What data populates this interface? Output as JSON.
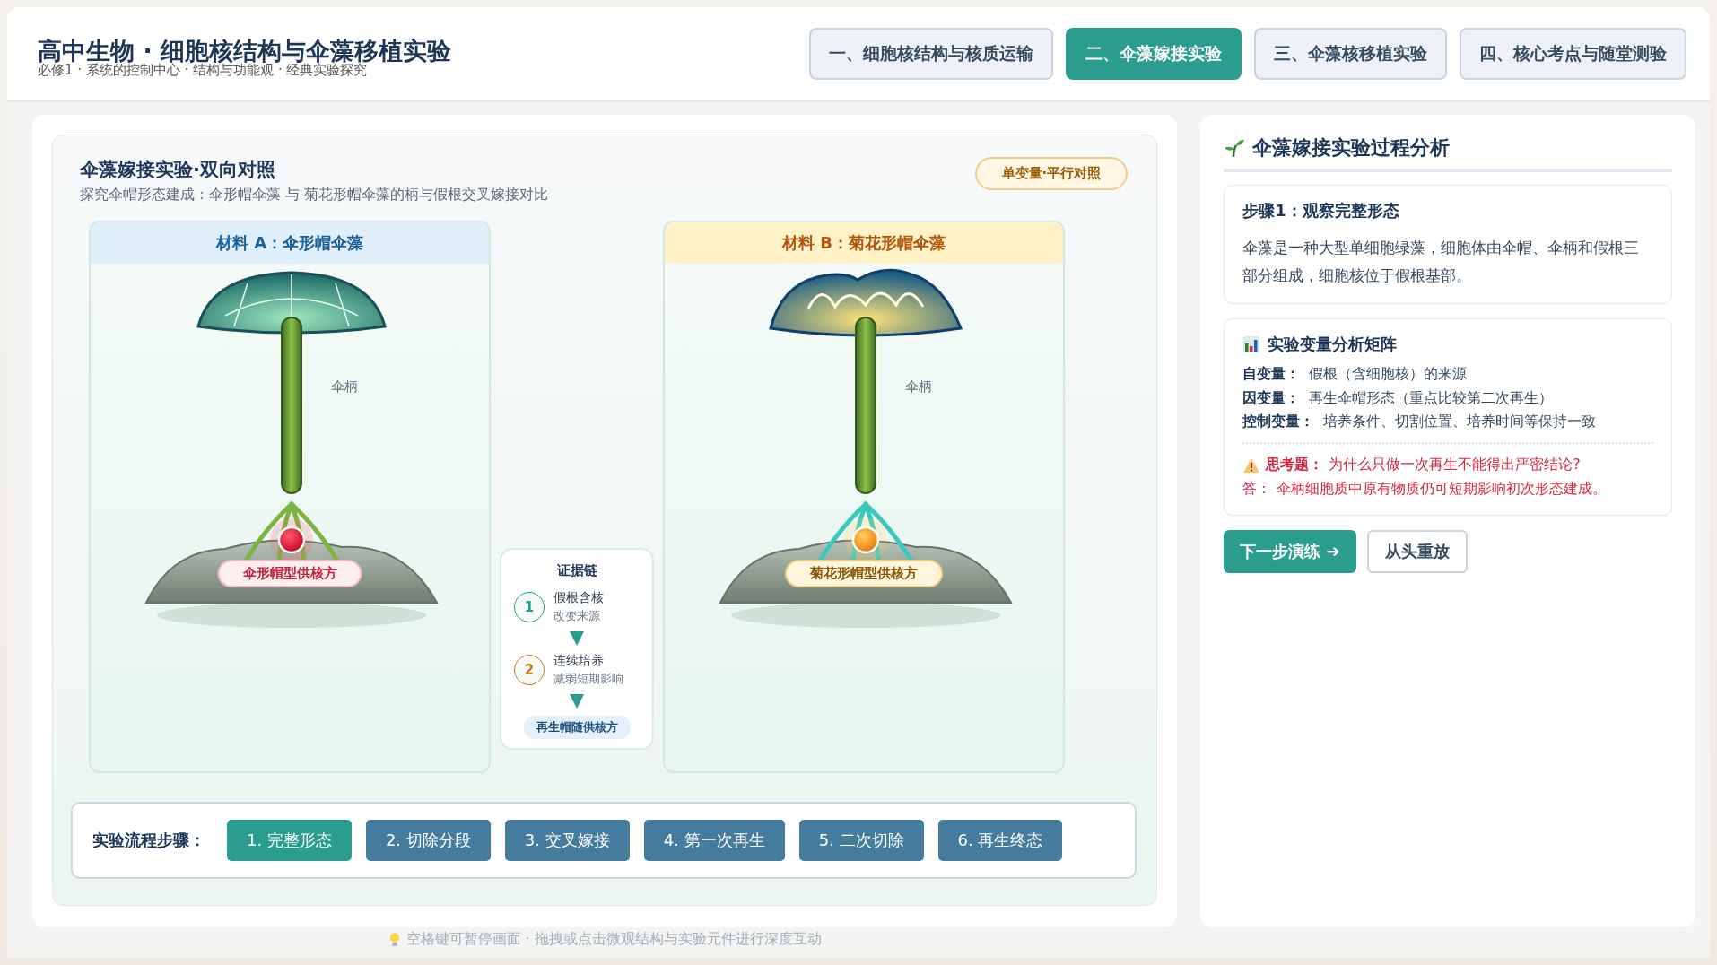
{
  "header": {
    "title": "高中生物 · 细胞核结构与伞藻移植实验",
    "subtitle": "必修1 · 系统的控制中心 · 结构与功能观 · 经典实验探究"
  },
  "tabs": [
    {
      "label": "一、细胞核结构与核质运输",
      "selected": false
    },
    {
      "label": "二、伞藻嫁接实验",
      "selected": true
    },
    {
      "label": "三、伞藻核移植实验",
      "selected": false
    },
    {
      "label": "四、核心考点与随堂测验",
      "selected": false
    }
  ],
  "stage": {
    "title": "伞藻嫁接实验·双向对照",
    "subtitle": "探究伞帽形态建成：伞形帽伞藻 与 菊花形帽伞藻的柄与假根交叉嫁接对比",
    "badge": "单变量·平行对照",
    "materials": [
      {
        "kind": "umbrella",
        "title": "材料 A：伞形帽伞藻",
        "stalk_label": "伞柄",
        "donor_label": "伞形帽型供核方"
      },
      {
        "kind": "chrysanthemum",
        "title": "材料 B：菊花形帽伞藻",
        "stalk_label": "伞柄",
        "donor_label": "菊花形帽型供核方"
      }
    ],
    "evidence": {
      "title": "证据链",
      "steps": [
        {
          "number": "1",
          "title": "假根含核",
          "note": "改变来源",
          "color": "#2a9d8f"
        },
        {
          "number": "2",
          "title": "连续培养",
          "note": "减弱短期影响",
          "color": "#c77d12"
        }
      ],
      "result": "再生帽随供核方"
    },
    "process": {
      "label": "实验流程步骤：",
      "steps": [
        {
          "label": "1. 完整形态",
          "selected": true
        },
        {
          "label": "2. 切除分段",
          "selected": false
        },
        {
          "label": "3. 交叉嫁接",
          "selected": false
        },
        {
          "label": "4. 第一次再生",
          "selected": false
        },
        {
          "label": "5. 二次切除",
          "selected": false
        },
        {
          "label": "6. 再生终态",
          "selected": false
        }
      ]
    }
  },
  "hint": "空格键可暂停画面 · 拖拽或点击微观结构与实验元件进行深度互动",
  "analysis": {
    "title": "伞藻嫁接实验过程分析",
    "step_card": {
      "title": "步骤1：观察完整形态",
      "text": "伞藻是一种大型单细胞绿藻，细胞体由伞帽、伞柄和假根三部分组成，细胞核位于假根基部。"
    },
    "matrix": {
      "title": "实验变量分析矩阵",
      "rows": [
        {
          "label": "自变量：",
          "value": "假根（含细胞核）的来源"
        },
        {
          "label": "因变量：",
          "value": "再生伞帽形态（重点比较第二次再生）"
        },
        {
          "label": "控制变量：",
          "value": "培养条件、切割位置、培养时间等保持一致"
        }
      ],
      "question": {
        "label": "思考题：",
        "text": "为什么只做一次再生不能得出严密结论?"
      },
      "answer": {
        "label": "答：",
        "text": "伞柄细胞质中原有物质仍可短期影响初次形态建成。"
      }
    },
    "buttons": [
      {
        "label": "下一步演练 ➔",
        "kind": "primary"
      },
      {
        "label": "从头重放",
        "kind": "secondary"
      }
    ]
  }
}
